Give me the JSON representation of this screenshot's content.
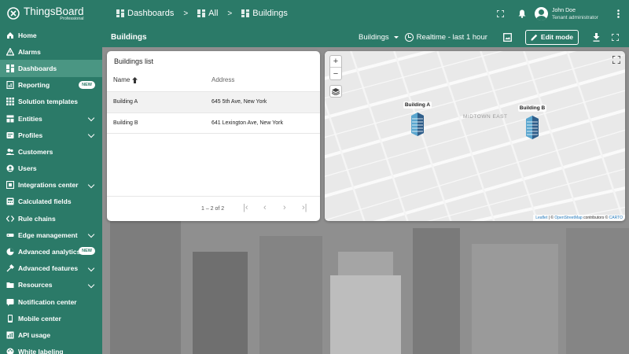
{
  "brand": {
    "name": "ThingsBoard",
    "edition": "Professional"
  },
  "sidebar": {
    "items": [
      {
        "label": "Home",
        "icon": "home-icon"
      },
      {
        "label": "Alarms",
        "icon": "alarm-icon"
      },
      {
        "label": "Dashboards",
        "icon": "dashboard-icon",
        "active": true
      },
      {
        "label": "Reporting",
        "icon": "report-icon",
        "badge": "NEW"
      },
      {
        "label": "Solution templates",
        "icon": "grid-icon"
      },
      {
        "label": "Entities",
        "icon": "entities-icon",
        "expandable": true
      },
      {
        "label": "Profiles",
        "icon": "profiles-icon",
        "expandable": true
      },
      {
        "label": "Customers",
        "icon": "customers-icon"
      },
      {
        "label": "Users",
        "icon": "user-icon"
      },
      {
        "label": "Integrations center",
        "icon": "integration-icon",
        "expandable": true
      },
      {
        "label": "Calculated fields",
        "icon": "calc-icon"
      },
      {
        "label": "Rule chains",
        "icon": "code-icon"
      },
      {
        "label": "Edge management",
        "icon": "edge-icon",
        "expandable": true
      },
      {
        "label": "Advanced analytics",
        "icon": "analytics-icon",
        "badge": "NEW"
      },
      {
        "label": "Advanced features",
        "icon": "tools-icon",
        "expandable": true
      },
      {
        "label": "Resources",
        "icon": "folder-icon",
        "expandable": true
      },
      {
        "label": "Notification center",
        "icon": "notification-icon"
      },
      {
        "label": "Mobile center",
        "icon": "mobile-icon"
      },
      {
        "label": "API usage",
        "icon": "api-icon"
      },
      {
        "label": "White labeling",
        "icon": "palette-icon"
      }
    ]
  },
  "breadcrumb": [
    {
      "label": "Dashboards"
    },
    {
      "label": "All"
    },
    {
      "label": "Buildings"
    }
  ],
  "user": {
    "name": "John Doe",
    "role": "Tenant administrator"
  },
  "dashboard": {
    "title": "Buildings",
    "state_label": "Buildings",
    "timewindow": "Realtime - last 1 hour",
    "edit_label": "Edit mode"
  },
  "list_widget": {
    "title": "Buildings list",
    "columns": {
      "name": "Name",
      "address": "Address"
    },
    "rows": [
      {
        "name": "Building A",
        "address": "645 5th Ave, New York"
      },
      {
        "name": "Building B",
        "address": "641 Lexington Ave, New York"
      }
    ],
    "pagination": "1 – 2 of 2"
  },
  "map_widget": {
    "markers": [
      {
        "label": "Building A"
      },
      {
        "label": "Building B"
      }
    ],
    "area_label": "MIDTOWN EAST",
    "attribution": {
      "leaflet": "Leaflet",
      "sep1": " | © ",
      "osm": "OpenStreetMap",
      "mid": " contributors © ",
      "carto": "CARTO"
    }
  }
}
